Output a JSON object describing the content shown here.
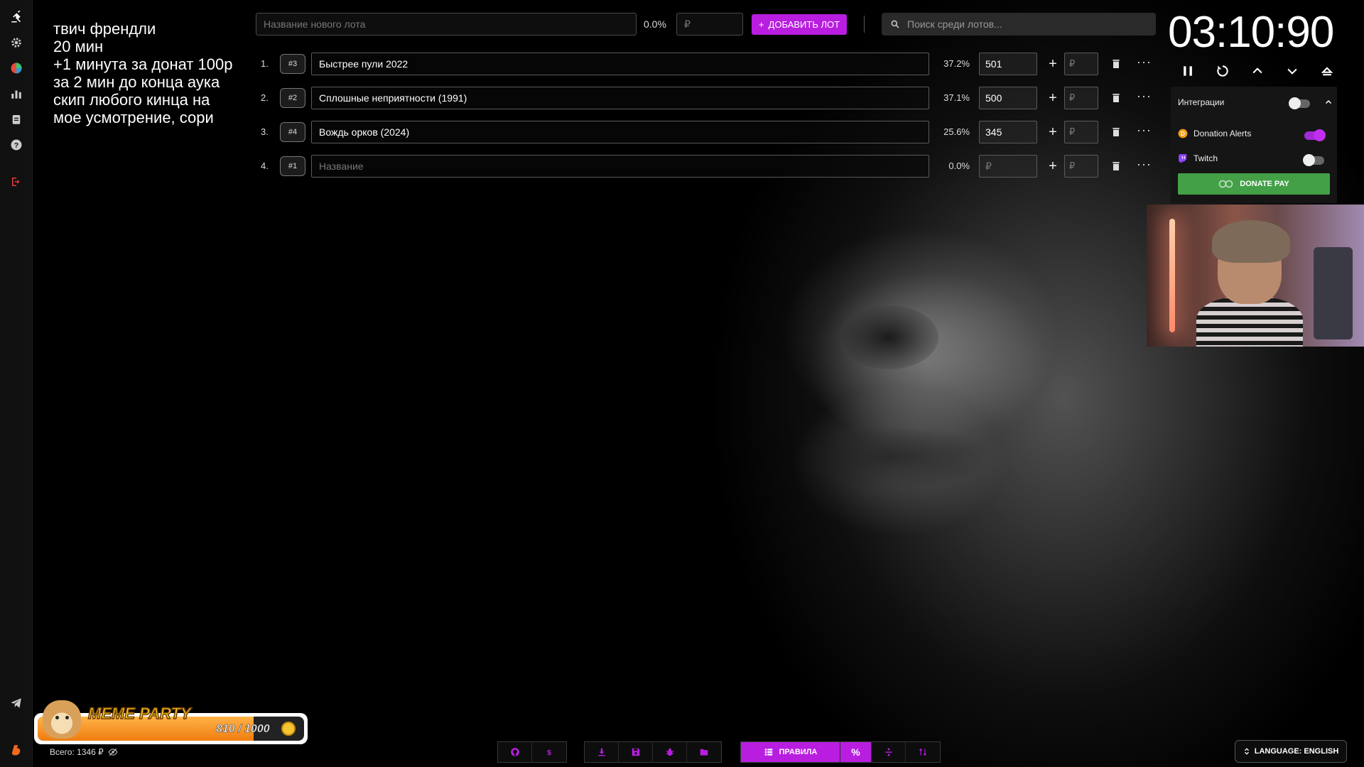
{
  "notes": "твич френдли\n20 мин\n+1 минута за донат 100р\nза 2 мин до конца аука\nскип любого кинца на\nмое усмотрение, сори",
  "topbar": {
    "new_lot_placeholder": "Название нового лота",
    "new_lot_percent": "0.0%",
    "amount_placeholder": "₽",
    "add_lot_label": "ДОБАВИТЬ ЛОТ",
    "search_placeholder": "Поиск среди лотов..."
  },
  "lots": [
    {
      "index": "1.",
      "id": "#3",
      "name": "Быстрее пули 2022",
      "percent": "37.2%",
      "amount": "501",
      "extra": "₽"
    },
    {
      "index": "2.",
      "id": "#2",
      "name": "Сплошные неприятности (1991)",
      "percent": "37.1%",
      "amount": "500",
      "extra": "₽"
    },
    {
      "index": "3.",
      "id": "#4",
      "name": "Вождь орков (2024)",
      "percent": "25.6%",
      "amount": "345",
      "extra": "₽"
    },
    {
      "index": "4.",
      "id": "#1",
      "name_placeholder": "Название",
      "percent": "0.0%",
      "amount_placeholder": "₽",
      "extra": "₽"
    }
  ],
  "timer": {
    "value": "03:10:90"
  },
  "integrations": {
    "title": "Интеграции",
    "items": [
      {
        "name": "Donation Alerts",
        "enabled": true,
        "color": "#f59c1a"
      },
      {
        "name": "Twitch",
        "enabled": false,
        "color": "#9146ff"
      }
    ],
    "donatepay_label": "DONATE PAY"
  },
  "meme_party": {
    "title": "MEME PARTY",
    "count": "810 / 1000",
    "progress": 0.81
  },
  "total_label": "Всего: 1346 ₽",
  "bottom_toolbar": {
    "rules_label": "ПРАВИЛА",
    "percent_label": "%"
  },
  "language_label": "LANGUAGE: ENGLISH",
  "colors": {
    "accent": "#b91ee0",
    "donatepay": "#43a047",
    "timer_text": "#ffffff"
  }
}
